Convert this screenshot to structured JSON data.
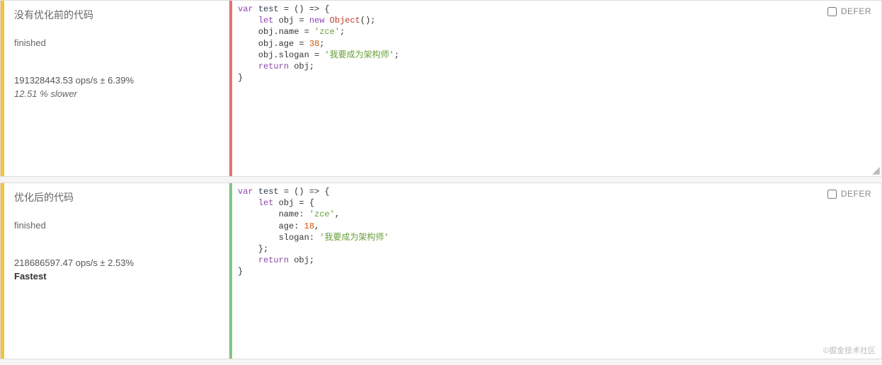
{
  "tests": [
    {
      "title": "没有优化前的代码",
      "status": "finished",
      "ops": "191328443.53 ops/s ± 6.39%",
      "result": "12.51 % slower",
      "resultClass": "result-slower",
      "barColor": "red",
      "defer": "DEFER",
      "code_tokens": [
        {
          "t": "kw",
          "v": "var"
        },
        {
          "t": "",
          "v": " "
        },
        {
          "t": "fn",
          "v": "test"
        },
        {
          "t": "",
          "v": " = () => {"
        },
        {
          "t": "br"
        },
        {
          "t": "",
          "v": "    "
        },
        {
          "t": "kw",
          "v": "let"
        },
        {
          "t": "",
          "v": " obj = "
        },
        {
          "t": "kw",
          "v": "new"
        },
        {
          "t": "",
          "v": " "
        },
        {
          "t": "obj",
          "v": "Object"
        },
        {
          "t": "",
          "v": "();"
        },
        {
          "t": "br"
        },
        {
          "t": "",
          "v": "    obj.name = "
        },
        {
          "t": "str",
          "v": "'zce'"
        },
        {
          "t": "",
          "v": ";"
        },
        {
          "t": "br"
        },
        {
          "t": "",
          "v": "    obj.age = "
        },
        {
          "t": "num",
          "v": "38"
        },
        {
          "t": "",
          "v": ";"
        },
        {
          "t": "br"
        },
        {
          "t": "",
          "v": "    obj.slogan = "
        },
        {
          "t": "str",
          "v": "'我要成为架构师'"
        },
        {
          "t": "",
          "v": ";"
        },
        {
          "t": "br"
        },
        {
          "t": "",
          "v": "    "
        },
        {
          "t": "kw",
          "v": "return"
        },
        {
          "t": "",
          "v": " obj;"
        },
        {
          "t": "br"
        },
        {
          "t": "",
          "v": "}"
        }
      ]
    },
    {
      "title": "优化后的代码",
      "status": "finished",
      "ops": "218686597.47 ops/s ± 2.53%",
      "result": "Fastest",
      "resultClass": "result-fastest",
      "barColor": "green",
      "defer": "DEFER",
      "code_tokens": [
        {
          "t": "kw",
          "v": "var"
        },
        {
          "t": "",
          "v": " "
        },
        {
          "t": "fn",
          "v": "test"
        },
        {
          "t": "",
          "v": " = () => {"
        },
        {
          "t": "br"
        },
        {
          "t": "",
          "v": "    "
        },
        {
          "t": "kw",
          "v": "let"
        },
        {
          "t": "",
          "v": " obj = {"
        },
        {
          "t": "br"
        },
        {
          "t": "",
          "v": "        name: "
        },
        {
          "t": "str",
          "v": "'zce'"
        },
        {
          "t": "",
          "v": ","
        },
        {
          "t": "br"
        },
        {
          "t": "",
          "v": "        age: "
        },
        {
          "t": "num",
          "v": "18"
        },
        {
          "t": "",
          "v": ","
        },
        {
          "t": "br"
        },
        {
          "t": "",
          "v": "        slogan: "
        },
        {
          "t": "str",
          "v": "'我要成为架构师'"
        },
        {
          "t": "br"
        },
        {
          "t": "",
          "v": "    };"
        },
        {
          "t": "br"
        },
        {
          "t": "",
          "v": "    "
        },
        {
          "t": "kw",
          "v": "return"
        },
        {
          "t": "",
          "v": " obj;"
        },
        {
          "t": "br"
        },
        {
          "t": "",
          "v": "}"
        }
      ]
    }
  ],
  "watermark": "©掘金技术社区"
}
